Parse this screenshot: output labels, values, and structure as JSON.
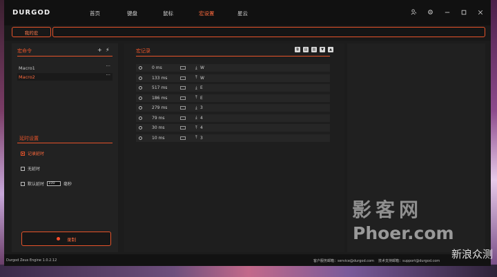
{
  "app": {
    "logo": "DURGOD",
    "nav": [
      "首页",
      "键盘",
      "鼠标",
      "宏设置",
      "星云"
    ],
    "active_nav": "宏设置",
    "accent": "#e8542a"
  },
  "macro_bar": {
    "my_macro_label": "我的宏",
    "macro_name_value": ""
  },
  "left": {
    "title": "宏命令",
    "macros": [
      {
        "name": "Macro1",
        "menu": "···"
      },
      {
        "name": "Macro2",
        "menu": "···"
      }
    ],
    "selected_macro": "Macro2",
    "delay_title": "延时设置",
    "delay_options": {
      "record": "记录延时",
      "none": "无延时",
      "default_label": "默认延时",
      "default_value": "100",
      "unit": "毫秒"
    },
    "record_button": "录制"
  },
  "center": {
    "title": "宏记录",
    "records": [
      {
        "time": "0 ms",
        "dir": "down",
        "key": "W"
      },
      {
        "time": "133 ms",
        "dir": "up",
        "key": "W"
      },
      {
        "time": "517 ms",
        "dir": "down",
        "key": "E"
      },
      {
        "time": "186 ms",
        "dir": "up",
        "key": "E"
      },
      {
        "time": "279 ms",
        "dir": "down",
        "key": "3"
      },
      {
        "time": "79 ms",
        "dir": "down",
        "key": "4"
      },
      {
        "time": "30 ms",
        "dir": "up",
        "key": "4"
      },
      {
        "time": "10 ms",
        "dir": "up",
        "key": "3"
      }
    ]
  },
  "footer": {
    "version": "Durgod Zeus Engine 1.0.2.12",
    "service": "客户服务邮箱：service@durgod.com",
    "support": "技术支持邮箱：support@durgod.com"
  },
  "watermark": {
    "line1": "影客网",
    "line2": "Phoer.com",
    "line3": "新浪众测"
  }
}
